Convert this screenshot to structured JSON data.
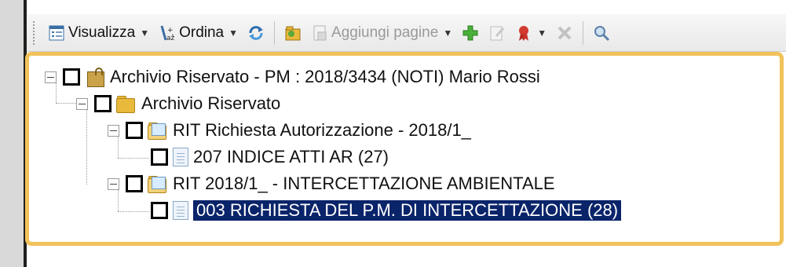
{
  "toolbar": {
    "visualizza_label": "Visualizza",
    "ordina_label": "Ordina",
    "aggiungi_pagine_label": "Aggiungi pagine",
    "icons": [
      "list-view-icon",
      "sort-az-icon",
      "refresh-icon",
      "folder-add-icon",
      "add-pages-icon",
      "add-green-icon",
      "edit-icon",
      "ribbon-icon",
      "delete-icon",
      "search-tree-icon"
    ]
  },
  "tree": {
    "root_label": "Archivio Riservato - PM : 2018/3434 (NOTI) Mario Rossi",
    "folder_label": "Archivio Riservato",
    "rit1_label": "RIT Richiesta Autorizzazione - 2018/1_",
    "doc1_label": "207 INDICE ATTI AR (27)",
    "rit2_label": "RIT 2018/1_ - INTERCETTAZIONE AMBIENTALE",
    "doc2_label": "003 RICHIESTA DEL P.M. DI INTERCETTAZIONE (28)"
  },
  "colors": {
    "highlight_frame": "#f1c25a",
    "selection_bg": "#0a246a"
  }
}
